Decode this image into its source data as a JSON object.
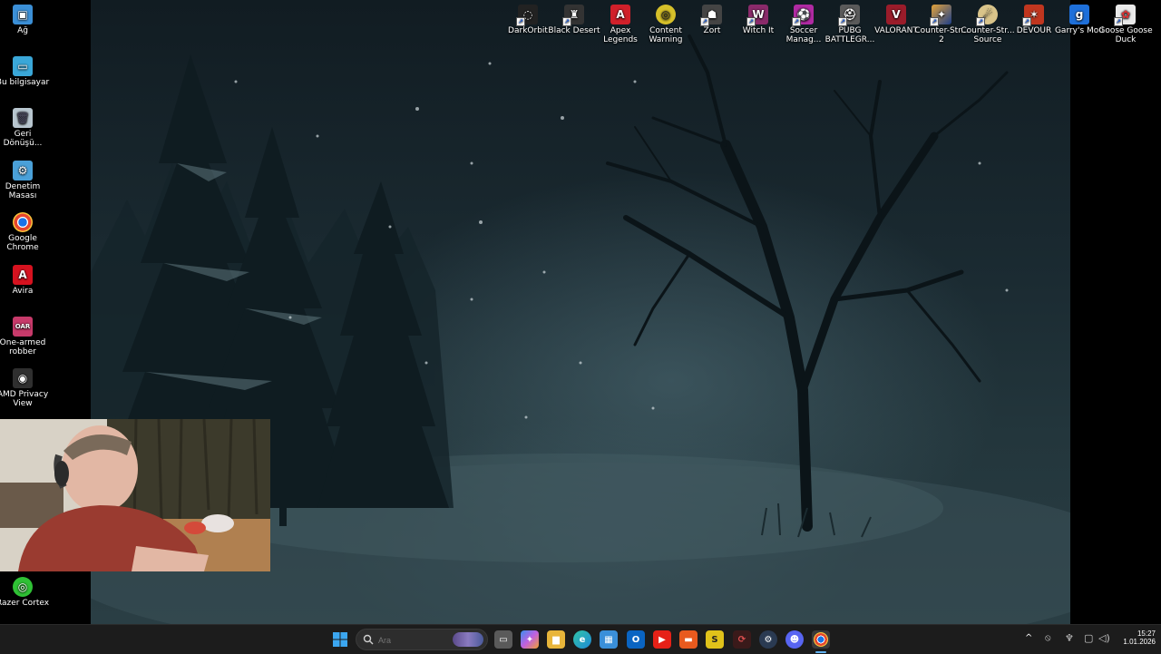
{
  "left_icons": [
    {
      "label": "Ağ",
      "icon": "network-icon",
      "color": "#3b8fd6"
    },
    {
      "label": "Bu bilgisayar",
      "icon": "computer-icon",
      "color": "#3aa7d8"
    },
    {
      "label": "Geri Dönüşü...",
      "icon": "recycle-bin-icon",
      "color": "#b8c6cf"
    },
    {
      "label": "Denetim Masası",
      "icon": "control-panel-icon",
      "color": "#4aa0d8"
    },
    {
      "label": "Google Chrome",
      "icon": "chrome-icon",
      "color": "#e5462f"
    },
    {
      "label": "Avira",
      "icon": "avira-icon",
      "color": "#d6121f"
    },
    {
      "label": "One-armed robber",
      "icon": "slot-machine-icon",
      "color": "#c73a6a"
    },
    {
      "label": "AMD Privacy View",
      "icon": "amd-icon",
      "color": "#2f2f2f"
    },
    {
      "label": "Razer Cortex",
      "icon": "razer-icon",
      "color": "#2fc135"
    }
  ],
  "top_icons": [
    {
      "label": "DarkOrbit",
      "icon": "darkorbit-icon",
      "color": "#222222"
    },
    {
      "label": "Black Desert",
      "icon": "black-desert-icon",
      "color": "#333333"
    },
    {
      "label": "Apex Legends",
      "icon": "apex-icon",
      "color": "#d0202a"
    },
    {
      "label": "Content Warning",
      "icon": "content-warning-icon",
      "color": "#d6c02a"
    },
    {
      "label": "Zort",
      "icon": "zort-icon",
      "color": "#444444"
    },
    {
      "label": "Witch It",
      "icon": "witch-it-icon",
      "color": "#8a2a6a"
    },
    {
      "label": "Soccer Manag...",
      "icon": "soccer-manager-icon",
      "color": "#b02aa2"
    },
    {
      "label": "PUBG BATTLEGR...",
      "icon": "pubg-icon",
      "color": "#5a5a5a"
    },
    {
      "label": "VALORANT",
      "icon": "valorant-icon",
      "color": "#9a1c2a"
    },
    {
      "label": "Counter-Str... 2",
      "icon": "cs2-icon",
      "color": "#e3a33a"
    },
    {
      "label": "Counter-Str... Source",
      "icon": "css-icon",
      "color": "#d9c48a"
    },
    {
      "label": "DEVOUR",
      "icon": "devour-icon",
      "color": "#c0361f"
    },
    {
      "label": "Garry's Mod",
      "icon": "garrys-mod-icon",
      "color": "#1e6fd9"
    },
    {
      "label": "Goose Goose Duck",
      "icon": "goose-goose-duck-icon",
      "color": "#e9e9e9"
    }
  ],
  "taskbar": {
    "search_placeholder": "Ara",
    "apps": [
      {
        "icon": "task-view-icon",
        "color": "#666666",
        "glyph": "▭"
      },
      {
        "icon": "copilot-icon",
        "color": "#6b6be0",
        "glyph": "✦"
      },
      {
        "icon": "file-explorer-icon",
        "color": "#e8b53a",
        "glyph": "▆"
      },
      {
        "icon": "edge-icon",
        "color": "#1f8ad6",
        "glyph": "e"
      },
      {
        "icon": "store-icon",
        "color": "#3a8fd9",
        "glyph": "▦"
      },
      {
        "icon": "outlook-icon",
        "color": "#0a64c2",
        "glyph": "O"
      },
      {
        "icon": "youtube-icon",
        "color": "#e62117",
        "glyph": "▶"
      },
      {
        "icon": "app-orange-icon",
        "color": "#e85a1e",
        "glyph": "▬"
      },
      {
        "icon": "app-yellow-s-icon",
        "color": "#e0c21a",
        "glyph": "S"
      },
      {
        "icon": "app-swirl-icon",
        "color": "#c9302c",
        "glyph": "⟳"
      },
      {
        "icon": "steam-icon",
        "color": "#2a3a52",
        "glyph": "⚙"
      },
      {
        "icon": "discord-icon",
        "color": "#5865f2",
        "glyph": "☻"
      },
      {
        "icon": "chrome-taskbar-icon",
        "color": "#e5462f",
        "glyph": "◉"
      }
    ],
    "time": "15:27",
    "date": "1.01.2026"
  }
}
